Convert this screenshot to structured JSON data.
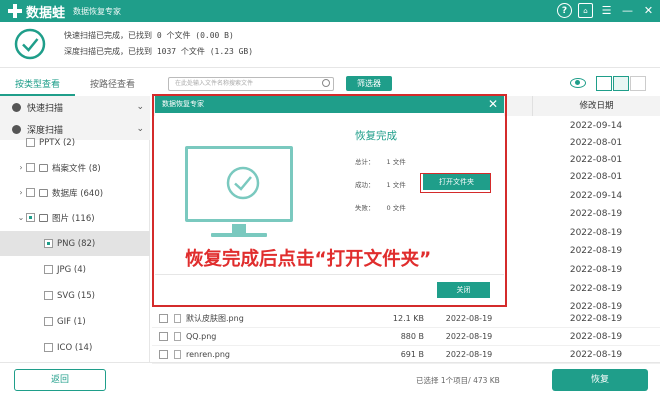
{
  "titlebar": {
    "brand": "数据蛙",
    "app_title": "数据恢复专家"
  },
  "summary": {
    "quick_scan": "快速扫描已完成，已找到 0 个文件 (0.00  B)",
    "deep_scan": "深度扫描已完成，已找到 1037 个文件 (1.23 GB)"
  },
  "sidebar": {
    "tabs": [
      "按类型查看",
      "按路径查看"
    ],
    "scan_rows": [
      "快速扫描",
      "深度扫描"
    ],
    "tree": [
      {
        "label": "PPTX (2)"
      },
      {
        "label": "档案文件 (8)"
      },
      {
        "label": "数据库 (640)"
      },
      {
        "label": "图片 (116)"
      },
      {
        "label": "PNG (82)"
      },
      {
        "label": "JPG (4)"
      },
      {
        "label": "SVG (15)"
      },
      {
        "label": "GIF (1)"
      },
      {
        "label": "ICO (14)"
      }
    ]
  },
  "toolbar": {
    "search_placeholder": "在此处输入文件名称搜索文件",
    "filter_label": "筛选器"
  },
  "table": {
    "date_header": "修改日期",
    "dates": [
      "2022-09-14",
      "2022-08-01",
      "2022-08-01",
      "2022-08-01",
      "2022-09-14",
      "2022-08-19",
      "2022-08-19",
      "2022-08-19",
      "2022-08-19",
      "2022-08-19",
      "2022-08-19"
    ],
    "rows": [
      {
        "name": "默认皮肤图.png",
        "size": "12.1 KB",
        "created": "2022-08-19",
        "modified": "2022-08-19"
      },
      {
        "name": "QQ.png",
        "size": "880  B",
        "created": "2022-08-19",
        "modified": "2022-08-19"
      },
      {
        "name": "renren.png",
        "size": "691  B",
        "created": "2022-08-19",
        "modified": "2022-08-19"
      }
    ]
  },
  "footer": {
    "back_label": "返回",
    "selection_info": "已选择 1个项目/ 473 KB",
    "recover_label": "恢复"
  },
  "dialog": {
    "header": "数据恢复专家",
    "title": "恢复完成",
    "stats": [
      {
        "label": "总计：",
        "value": "1 文件"
      },
      {
        "label": "成功：",
        "value": "1 文件"
      },
      {
        "label": "失败：",
        "value": "0 文件"
      }
    ],
    "open_folder_label": "打开文件夹",
    "close_label": "关闭",
    "annotation": "恢复完成后点击“打开文件夹”"
  },
  "colors": {
    "brand": "#1f9e8a",
    "annotation": "#d42b2b"
  }
}
